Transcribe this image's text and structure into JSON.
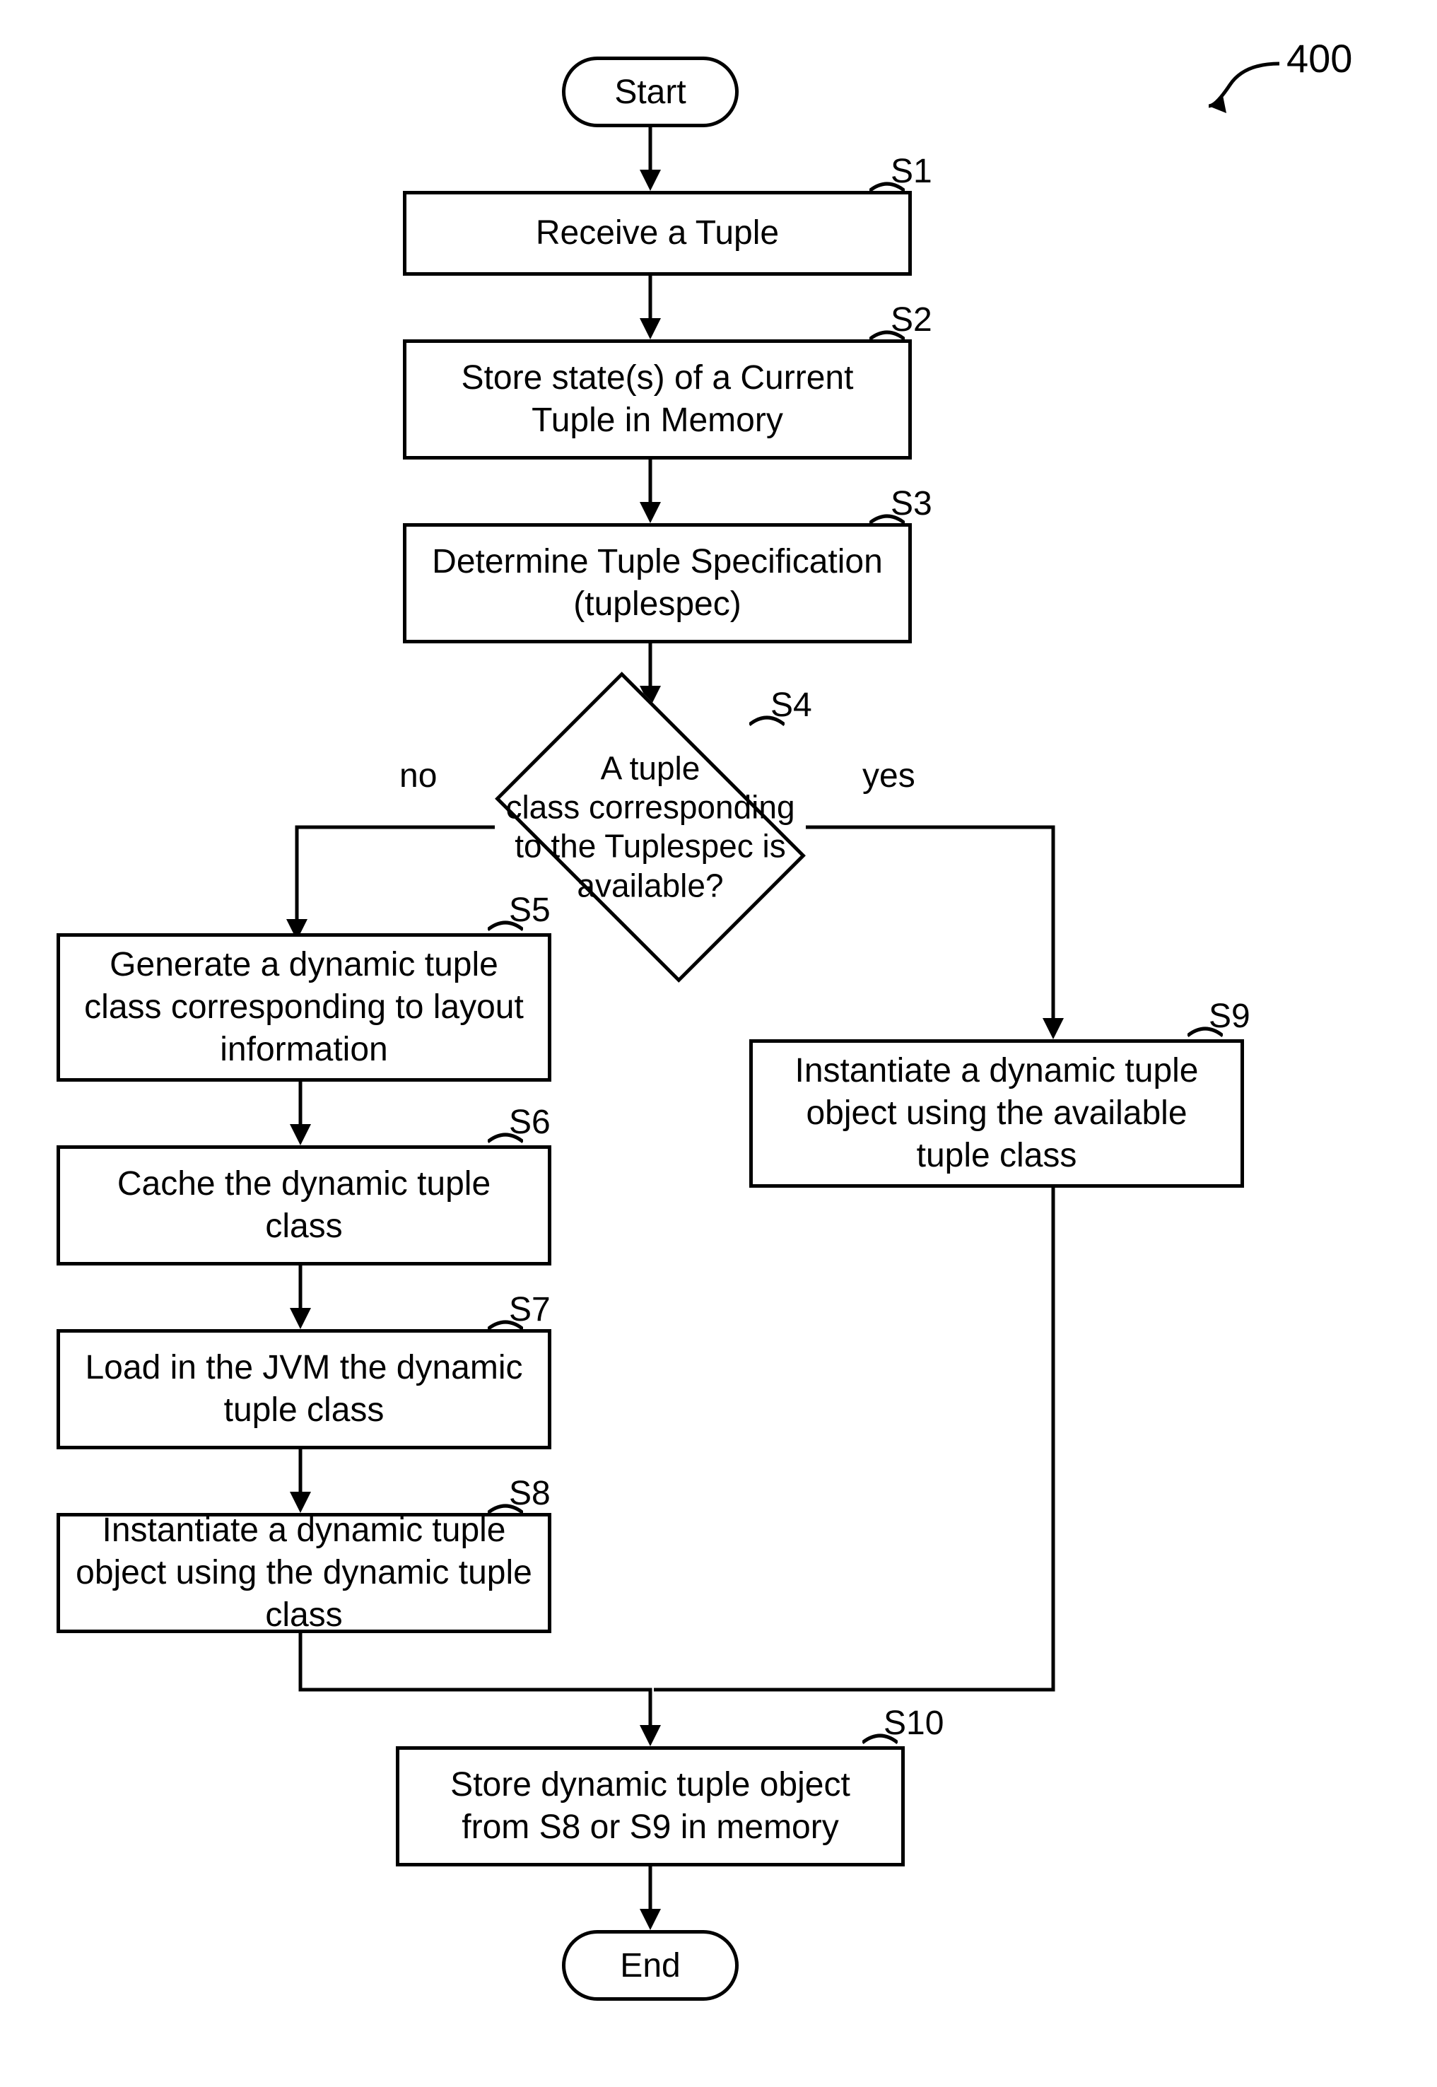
{
  "figref": "400",
  "start": "Start",
  "end": "End",
  "labels": {
    "s1": "S1",
    "s2": "S2",
    "s3": "S3",
    "s4": "S4",
    "s5": "S5",
    "s6": "S6",
    "s7": "S7",
    "s8": "S8",
    "s9": "S9",
    "s10": "S10",
    "no": "no",
    "yes": "yes"
  },
  "steps": {
    "s1": "Receive a Tuple",
    "s2": "Store state(s) of a Current Tuple in Memory",
    "s3": "Determine Tuple Specification (tuplespec)",
    "s4_l1": "A tuple",
    "s4_l2": "class corresponding",
    "s4_l3": "to the Tuplespec is",
    "s4_l4": "available?",
    "s5": "Generate a dynamic tuple class corresponding to layout information",
    "s6": "Cache the dynamic tuple class",
    "s7": "Load in the JVM the dynamic tuple class",
    "s8": "Instantiate a dynamic tuple object using the dynamic tuple class",
    "s9": "Instantiate a dynamic tuple object using the available tuple class",
    "s10": "Store dynamic tuple object from S8 or S9 in memory"
  }
}
